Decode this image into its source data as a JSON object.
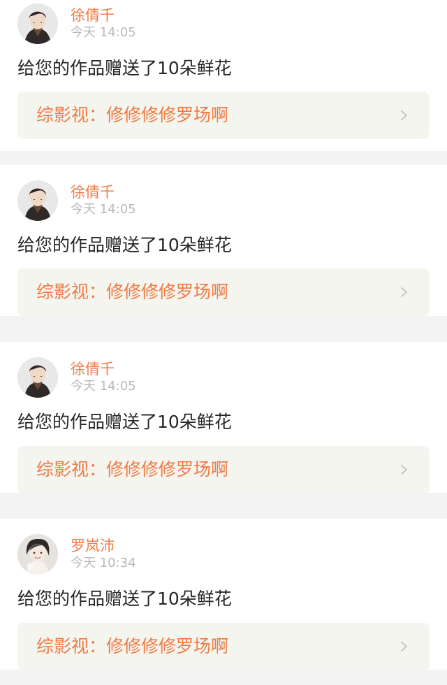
{
  "colors": {
    "accent": "#ef7b45",
    "text": "#262626",
    "muted": "#b8b8b8",
    "card_link_bg": "#f5f5ef",
    "page_bg": "#f3f3f3"
  },
  "notifications": [
    {
      "avatar_icon": "male-user-avatar",
      "user_name": "徐倩千",
      "time": "今天 14:05",
      "message": "给您的作品赠送了10朵鲜花",
      "work_link": "综影视：修修修修罗场啊",
      "arrow_icon": "chevron-right-icon"
    },
    {
      "avatar_icon": "male-user-avatar",
      "user_name": "徐倩千",
      "time": "今天 14:05",
      "message": "给您的作品赠送了10朵鲜花",
      "work_link": "综影视：修修修修罗场啊",
      "arrow_icon": "chevron-right-icon"
    },
    {
      "avatar_icon": "male-user-avatar",
      "user_name": "徐倩千",
      "time": "今天 14:05",
      "message": "给您的作品赠送了10朵鲜花",
      "work_link": "综影视：修修修修罗场啊",
      "arrow_icon": "chevron-right-icon"
    },
    {
      "avatar_icon": "female-user-avatar",
      "user_name": "罗岚沛",
      "time": "今天 10:34",
      "message": "给您的作品赠送了10朵鲜花",
      "work_link": "综影视：修修修修罗场啊",
      "arrow_icon": "chevron-right-icon"
    }
  ]
}
